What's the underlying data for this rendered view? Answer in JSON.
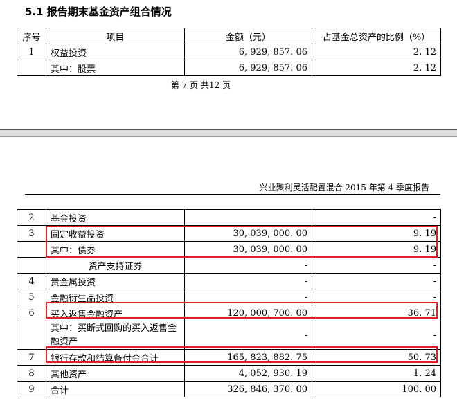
{
  "section_title": "5.1 报告期末基金资产组合情况",
  "headers": {
    "no": "序号",
    "item": "项目",
    "amount": "金额（元）",
    "ratio": "占基金总资产的比例（%）"
  },
  "top_rows": [
    {
      "no": "1",
      "item": "权益投资",
      "amount": "6, 929, 857. 06",
      "ratio": "2. 12"
    },
    {
      "no": "",
      "item": "其中：股票",
      "amount": "6, 929, 857. 06",
      "ratio": "2. 12"
    }
  ],
  "page_info": "第 7 页 共12 页",
  "running_header": "兴业聚利灵活配置混合 2015 年第 4 季度报告",
  "bottom_rows": [
    {
      "no": "2",
      "item": "基金投资",
      "amount": "",
      "ratio": "-"
    },
    {
      "no": "3",
      "item": "固定收益投资",
      "amount": "30, 039, 000. 00",
      "ratio": "9. 19"
    },
    {
      "no": "",
      "item": "其中：债券",
      "amount": "30, 039, 000. 00",
      "ratio": "9. 19"
    },
    {
      "no": "",
      "item": "资产支持证券",
      "amount": "-",
      "ratio": "-"
    },
    {
      "no": "4",
      "item": "贵金属投资",
      "amount": "-",
      "ratio": "-"
    },
    {
      "no": "5",
      "item": "金融衍生品投资",
      "amount": "-",
      "ratio": "-"
    },
    {
      "no": "6",
      "item": "买入返售金融资产",
      "amount": "120, 000, 700. 00",
      "ratio": "36. 71"
    },
    {
      "no": "",
      "item": "其中：买断式回购的买入返售金融资产",
      "amount": "-",
      "ratio": "-"
    },
    {
      "no": "7",
      "item": "银行存款和结算备付金合计",
      "amount": "165, 823, 882. 75",
      "ratio": "50. 73"
    },
    {
      "no": "8",
      "item": "其他资产",
      "amount": "4, 052, 930. 19",
      "ratio": "1. 24"
    },
    {
      "no": "9",
      "item": "合计",
      "amount": "326, 846, 370. 00",
      "ratio": "100. 00"
    }
  ],
  "highlight_color": "#e02020"
}
